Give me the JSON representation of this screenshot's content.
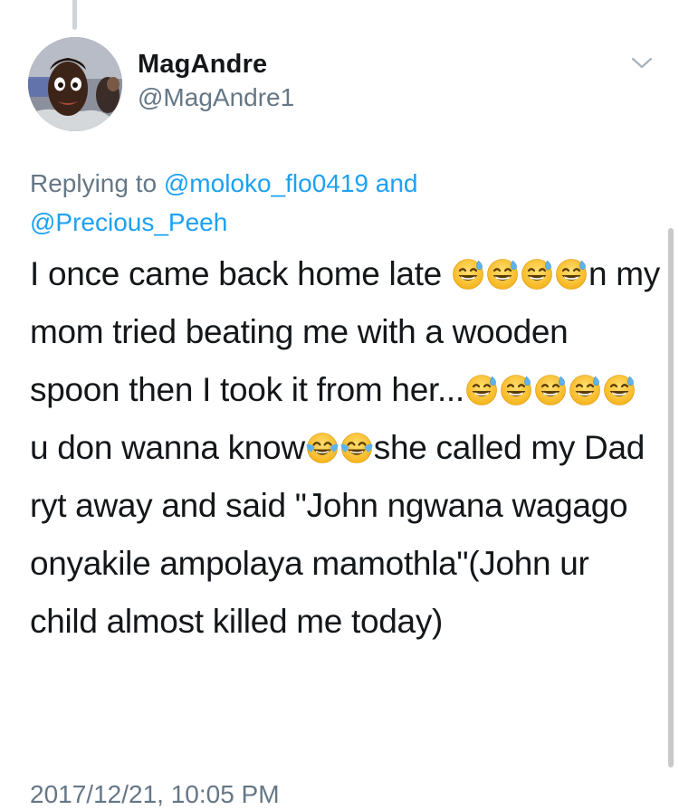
{
  "author": {
    "display_name": "MagAndre",
    "handle": "@MagAndre1"
  },
  "reply": {
    "prefix": "Replying to ",
    "mention1": "@moloko_flo0419",
    "conjunction": " and ",
    "mention2": "@Precious_Peeh"
  },
  "tweet": {
    "t1": "I once came back home late ",
    "t2": "n my mom tried beating me with a wooden spoon then I took it from her...",
    "t3": " u don wanna know",
    "t4": "she called my Dad ryt away and said \"John ngwana wagago onyakile ampolaya mamothla\"(John ur child almost killed me today)"
  },
  "timestamp": "2017/12/21, 10:05 PM",
  "icons": {
    "sweat_smile": "grinning-face-with-sweat",
    "joy": "face-with-tears-of-joy",
    "menu": "chevron-down"
  },
  "colors": {
    "text": "#14171a",
    "secondary": "#657786",
    "link": "#1da1f2",
    "thread_line": "#cdd4da"
  }
}
